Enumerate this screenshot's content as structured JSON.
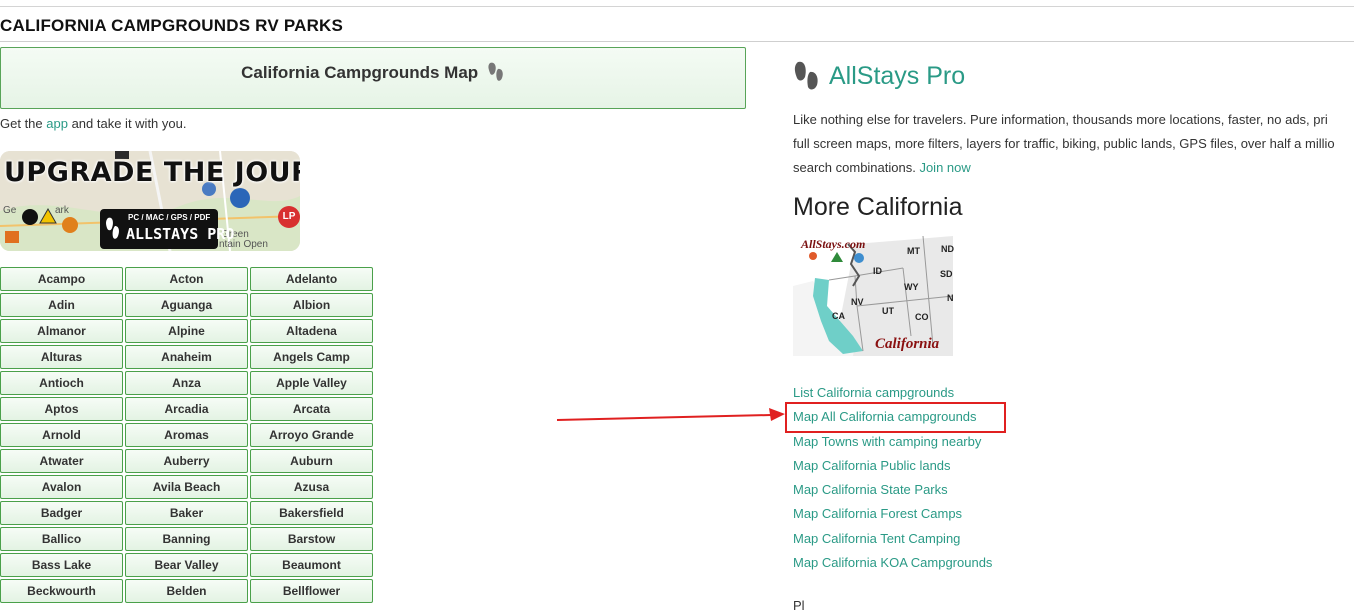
{
  "page": {
    "title": "CALIFORNIA CAMPGROUNDS RV PARKS"
  },
  "map_box": {
    "label": "California Campgrounds Map"
  },
  "get_app": {
    "before": "Get the ",
    "link": "app",
    "after": " and take it with you."
  },
  "banner": {
    "headline": "UPGRADE THE JOURNEY",
    "badge_sub": "PC / MAC / GPS / PDF",
    "badge_main": "ALLSTAYS PRO",
    "lp_badge": "LP",
    "map_labels": [
      "Ge",
      "ark",
      "Green",
      "ntain Open"
    ]
  },
  "towns": [
    "Acampo",
    "Acton",
    "Adelanto",
    "Adin",
    "Aguanga",
    "Albion",
    "Almanor",
    "Alpine",
    "Altadena",
    "Alturas",
    "Anaheim",
    "Angels Camp",
    "Antioch",
    "Anza",
    "Apple Valley",
    "Aptos",
    "Arcadia",
    "Arcata",
    "Arnold",
    "Aromas",
    "Arroyo Grande",
    "Atwater",
    "Auberry",
    "Auburn",
    "Avalon",
    "Avila Beach",
    "Azusa",
    "Badger",
    "Baker",
    "Bakersfield",
    "Ballico",
    "Banning",
    "Barstow",
    "Bass Lake",
    "Bear Valley",
    "Beaumont",
    "Beckwourth",
    "Belden",
    "Bellflower"
  ],
  "pro": {
    "title": "AllStays Pro",
    "desc_line1": "Like nothing else for travelers. Pure information, thousands more locations, faster, no ads, pri",
    "desc_line2": "full screen maps, more filters, layers for traffic, biking, public lands, GPS files, over half a millio",
    "desc_line3": "search combinations. ",
    "join_link": "Join now"
  },
  "more": {
    "title": "More California"
  },
  "state_map": {
    "brand": "AllStays.com",
    "caption": "California",
    "states": [
      "ND",
      "MT",
      "SD",
      "ID",
      "WY",
      "N",
      "NV",
      "UT",
      "CO",
      "CA"
    ]
  },
  "links": [
    "List California campgrounds",
    "Map All California campgrounds",
    "Map Towns with camping nearby",
    "Map California Public lands",
    "Map California State Parks",
    "Map California Forest Camps",
    "Map California Tent Camping",
    "Map California KOA Campgrounds"
  ],
  "partial_bottom": "Pl",
  "colors": {
    "link": "#2a9a86",
    "button_border": "#4aa04a",
    "highlight": "#e02020"
  },
  "icons": {
    "footprint": "allstays-footprint-icon"
  }
}
